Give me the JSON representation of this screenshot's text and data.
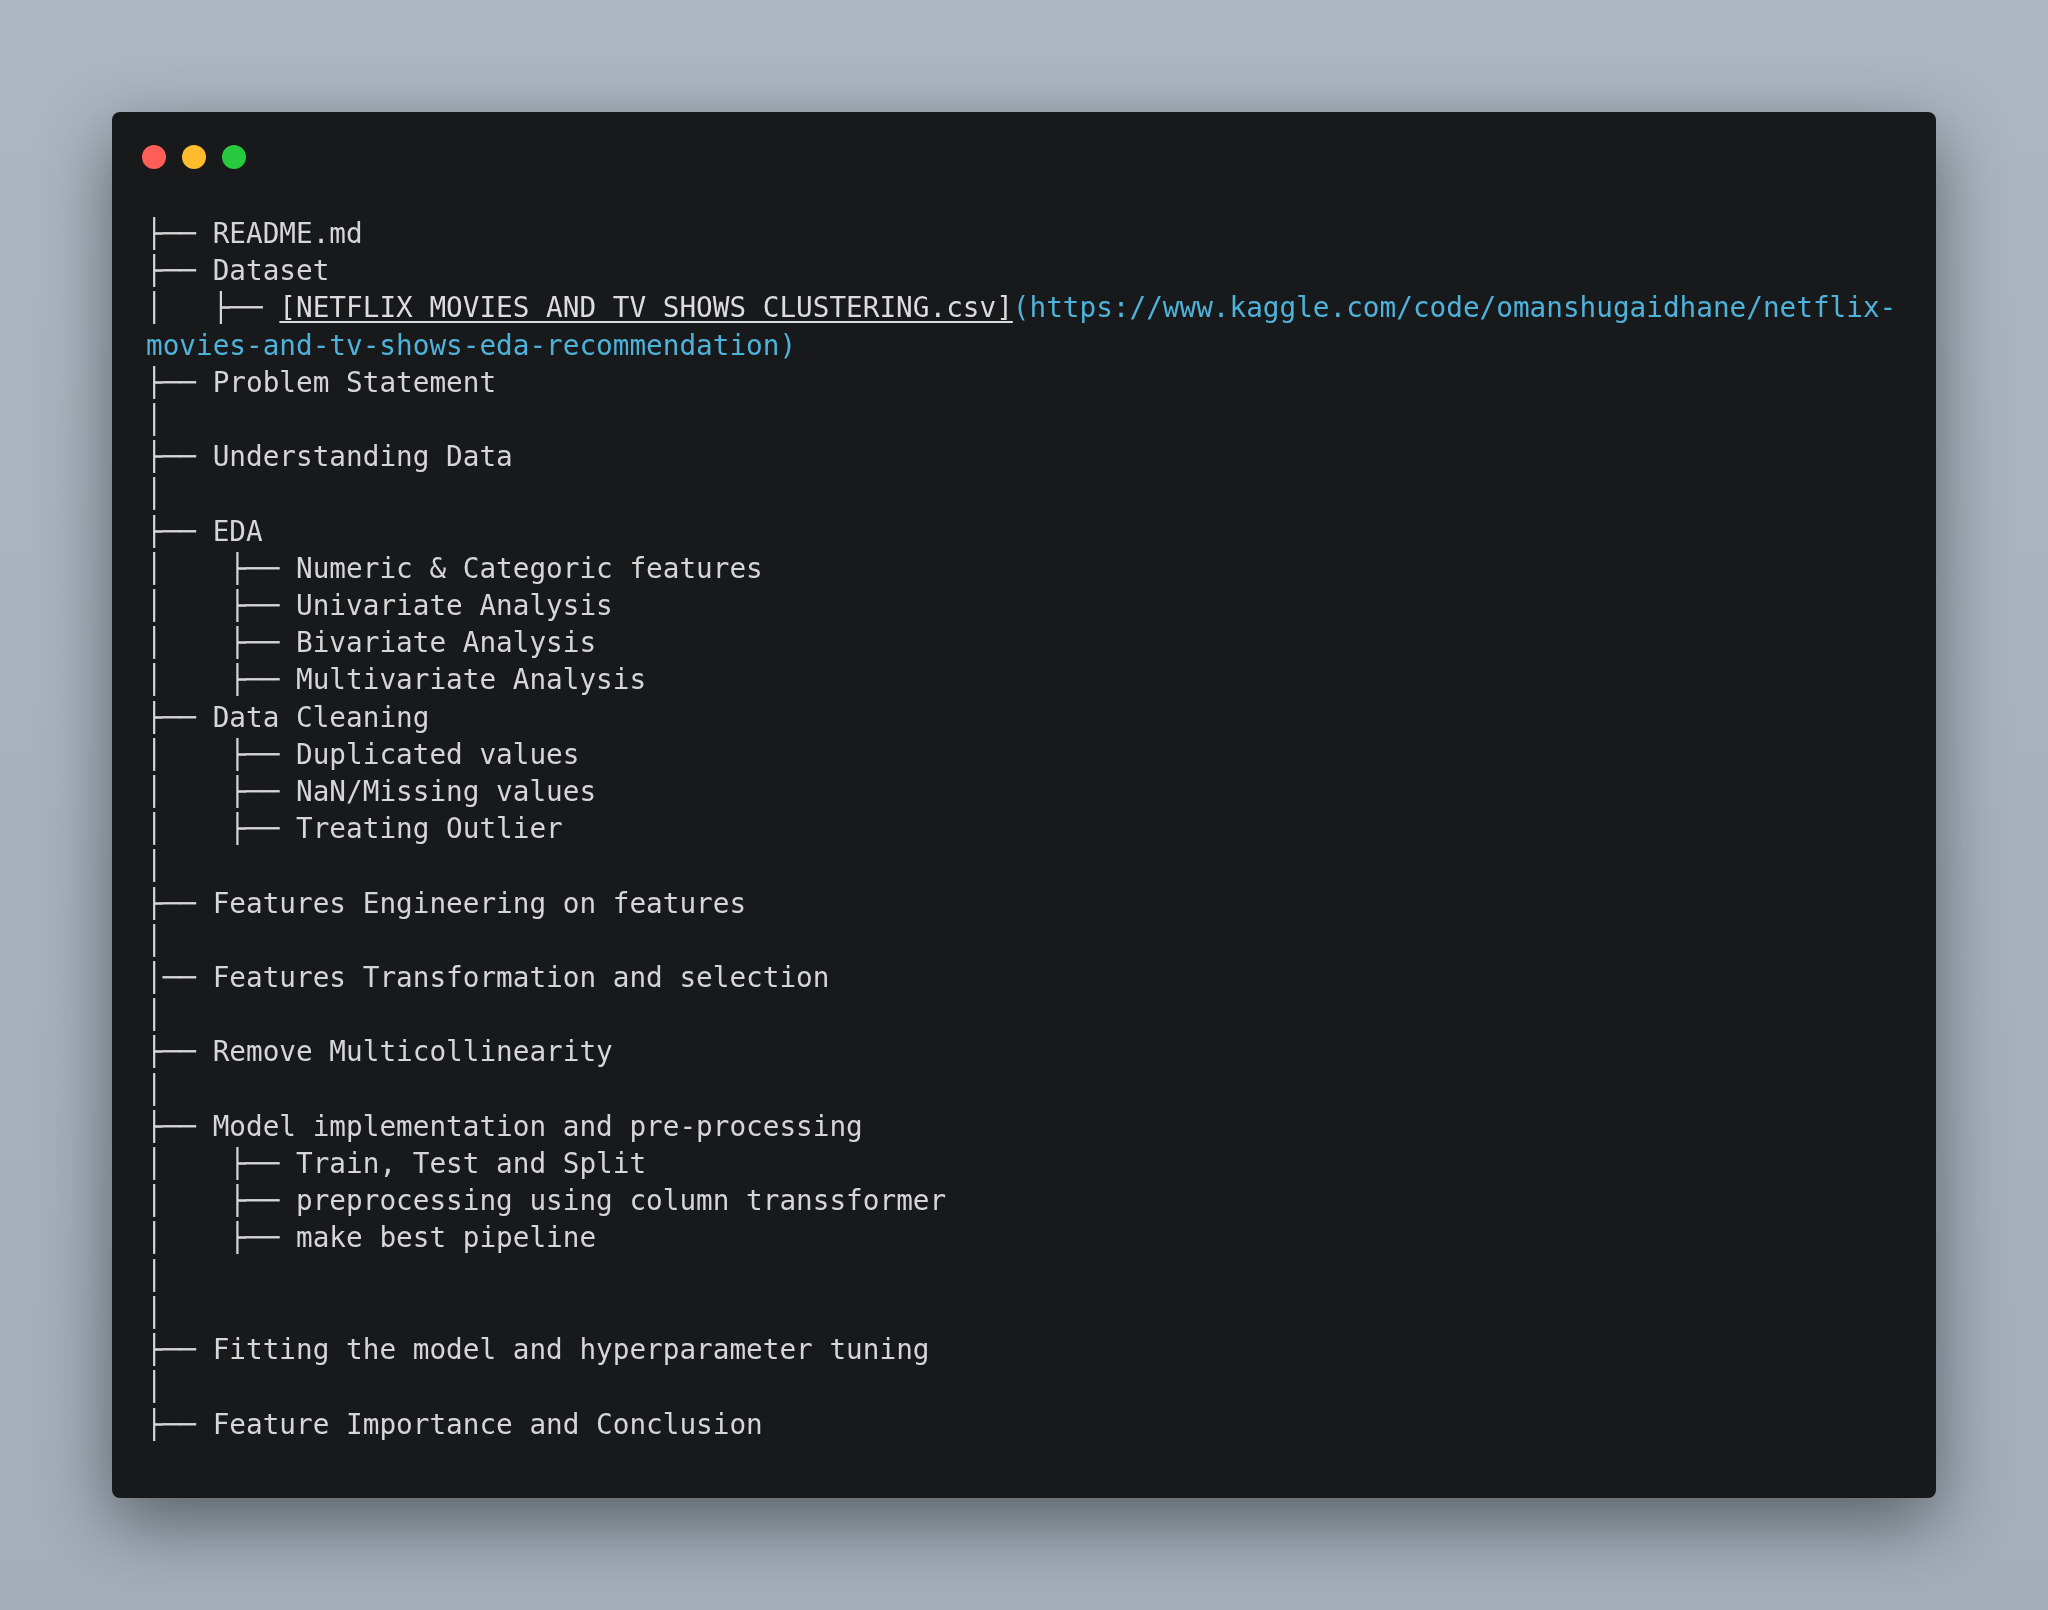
{
  "window": {
    "controls": [
      {
        "color": "#ff5f56"
      },
      {
        "color": "#ffbd2e"
      },
      {
        "color": "#27c93f"
      }
    ]
  },
  "lines": [
    {
      "kind": "item",
      "prefix": "├── ",
      "text": "README.md"
    },
    {
      "kind": "item",
      "prefix": "├── ",
      "text": "Dataset"
    },
    {
      "kind": "link",
      "prefix": "│   ├── ",
      "link_text": "[NETFLIX MOVIES AND TV SHOWS CLUSTERING.csv]",
      "url": "(https://www.kaggle.com/code/omanshugaidhane/netflix-",
      "url_continued": "movies-and-tv-shows-eda-recommendation)"
    },
    {
      "kind": "item",
      "prefix": "├── ",
      "text": "Problem Statement"
    },
    {
      "kind": "bar",
      "prefix": "│"
    },
    {
      "kind": "item",
      "prefix": "├── ",
      "text": "Understanding Data"
    },
    {
      "kind": "bar",
      "prefix": "│"
    },
    {
      "kind": "item",
      "prefix": "├── ",
      "text": "EDA"
    },
    {
      "kind": "item",
      "prefix": "│    ├── ",
      "text": "Numeric & Categoric features"
    },
    {
      "kind": "item",
      "prefix": "│    ├── ",
      "text": "Univariate Analysis"
    },
    {
      "kind": "item",
      "prefix": "│    ├── ",
      "text": "Bivariate Analysis"
    },
    {
      "kind": "item",
      "prefix": "│    ├── ",
      "text": "Multivariate Analysis"
    },
    {
      "kind": "item",
      "prefix": "├── ",
      "text": "Data Cleaning"
    },
    {
      "kind": "item",
      "prefix": "│    ├── ",
      "text": "Duplicated values"
    },
    {
      "kind": "item",
      "prefix": "│    ├── ",
      "text": "NaN/Missing values"
    },
    {
      "kind": "item",
      "prefix": "│    ├── ",
      "text": "Treating Outlier"
    },
    {
      "kind": "bar",
      "prefix": "│"
    },
    {
      "kind": "item",
      "prefix": "├── ",
      "text": "Features Engineering on features"
    },
    {
      "kind": "bar",
      "prefix": "│"
    },
    {
      "kind": "item",
      "prefix": "│── ",
      "text": "Features Transformation and selection"
    },
    {
      "kind": "bar",
      "prefix": "│"
    },
    {
      "kind": "item",
      "prefix": "├── ",
      "text": "Remove Multicollinearity"
    },
    {
      "kind": "bar",
      "prefix": "│"
    },
    {
      "kind": "item",
      "prefix": "├── ",
      "text": "Model implementation and pre-processing"
    },
    {
      "kind": "item",
      "prefix": "│    ├── ",
      "text": "Train, Test and Split"
    },
    {
      "kind": "item",
      "prefix": "│    ├── ",
      "text": "preprocessing using column transsformer"
    },
    {
      "kind": "item",
      "prefix": "│    ├── ",
      "text": "make best pipeline"
    },
    {
      "kind": "bar",
      "prefix": "│"
    },
    {
      "kind": "bar",
      "prefix": "│"
    },
    {
      "kind": "item",
      "prefix": "├── ",
      "text": "Fitting the model and hyperparameter tuning"
    },
    {
      "kind": "bar",
      "prefix": "│"
    },
    {
      "kind": "item",
      "prefix": "├── ",
      "text": "Feature Importance and Conclusion"
    }
  ]
}
